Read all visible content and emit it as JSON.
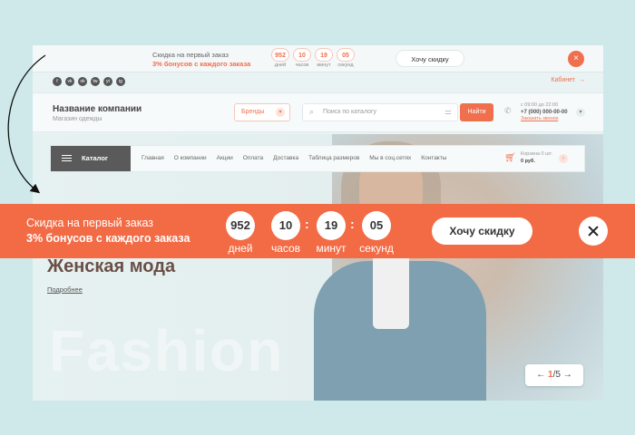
{
  "topbar": {
    "promo_line1": "Скидка на первый заказ",
    "promo_line2": "3% бонусов с каждого заказа",
    "counters": [
      {
        "value": "952",
        "unit": "дней"
      },
      {
        "value": "10",
        "unit": "часов"
      },
      {
        "value": "19",
        "unit": "минут"
      },
      {
        "value": "05",
        "unit": "секунд"
      }
    ],
    "button_label": "Хочу скидку",
    "close_glyph": "×"
  },
  "social": [
    "f",
    "vk",
    "ok",
    "tw",
    "yt",
    "ig"
  ],
  "cabinet": {
    "label": "Кабинет",
    "icon": "→"
  },
  "header": {
    "company_name": "Название компании",
    "company_sub": "Магазин одежды",
    "brands_label": "Бренды",
    "search_placeholder": "Поиск по каталогу",
    "search_button": "Найти",
    "hours": "с 09:00 до 22:00",
    "phone": "+7 (000) 000-00-00",
    "callback": "Заказать звонок"
  },
  "nav": {
    "catalog_label": "Каталог",
    "items": [
      "Главная",
      "О компании",
      "Акции",
      "Оплата",
      "Доставка",
      "Таблица размеров",
      "Мы в соц.сетях",
      "Контакты"
    ],
    "cart_line1": "Корзина 0 шт.",
    "cart_line2": "0 руб."
  },
  "hero": {
    "title": "Женская мода",
    "more_link": "Подробнее",
    "watermark": "Fashion",
    "slide_current": "1",
    "slide_total": "/5",
    "prev_glyph": "←",
    "next_glyph": "→"
  },
  "promo_bar": {
    "line1": "Скидка на первый заказ",
    "line2": "3% бонусов с каждого заказа",
    "counters": [
      {
        "value": "952",
        "unit": "дней"
      },
      {
        "value": "10",
        "unit": "часов"
      },
      {
        "value": "19",
        "unit": "минут"
      },
      {
        "value": "05",
        "unit": "секунд"
      }
    ],
    "separator": ":",
    "button_label": "Хочу скидку"
  },
  "colors": {
    "accent": "#f26b45",
    "background": "#cfe9ea"
  }
}
